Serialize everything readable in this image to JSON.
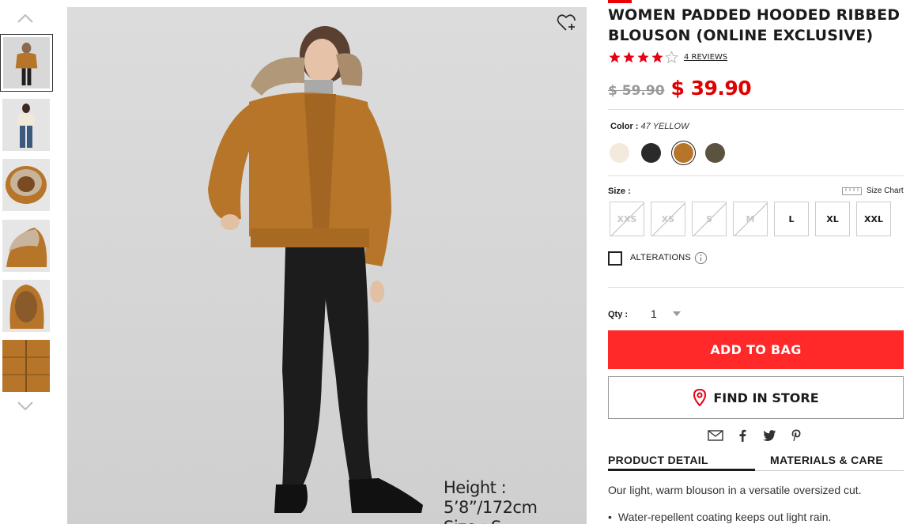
{
  "product": {
    "title": "WOMEN PADDED HOODED RIBBED BLOUSON (ONLINE EXCLUSIVE)",
    "rating": 4,
    "rating_max": 5,
    "reviews_link": "4 REVIEWS",
    "old_price": "$ 59.90",
    "new_price": "$ 39.90",
    "image_caption_height": "Height : 5’8”/172cm",
    "image_caption_size": "Size : S"
  },
  "color": {
    "label": "Color :",
    "selected_name": "47 YELLOW",
    "swatches": [
      {
        "name": "cream",
        "hex": "#f3e9dc"
      },
      {
        "name": "black",
        "hex": "#2a2a2a"
      },
      {
        "name": "yellow",
        "hex": "#b7752a"
      },
      {
        "name": "olive",
        "hex": "#5b5240"
      }
    ],
    "selected_index": 2
  },
  "size": {
    "label": "Size :",
    "chart_label": "Size Chart",
    "options": [
      {
        "label": "XXS",
        "available": false
      },
      {
        "label": "XS",
        "available": false
      },
      {
        "label": "S",
        "available": false
      },
      {
        "label": "M",
        "available": false
      },
      {
        "label": "L",
        "available": true
      },
      {
        "label": "XL",
        "available": true
      },
      {
        "label": "XXL",
        "available": true
      }
    ]
  },
  "alterations": {
    "label": "ALTERATIONS"
  },
  "qty": {
    "label": "Qty :",
    "value": "1"
  },
  "actions": {
    "add_to_bag": "ADD TO BAG",
    "find_in_store": "FIND IN STORE"
  },
  "tabs": [
    "PRODUCT DETAIL",
    "MATERIALS & CARE"
  ],
  "details": {
    "description": "Our light, warm blouson in a versatile oversized cut.",
    "bullets": [
      "Water-repellent coating keeps out light rain."
    ]
  },
  "colors": {
    "accent_red": "#ff2929",
    "price_red": "#e00000",
    "jacket": "#b7752a"
  }
}
